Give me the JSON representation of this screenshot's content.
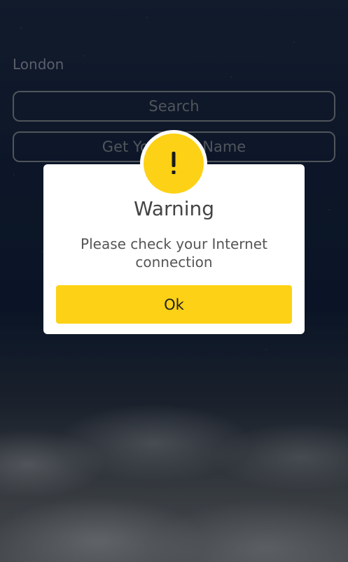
{
  "form": {
    "city_value": "London",
    "search_label": "Search",
    "name_label": "Get Your City Name"
  },
  "alert": {
    "icon": "exclamation-icon",
    "title": "Warning",
    "message": "Please check your Internet connection",
    "ok_label": "Ok",
    "accent_color": "#FDD116"
  }
}
